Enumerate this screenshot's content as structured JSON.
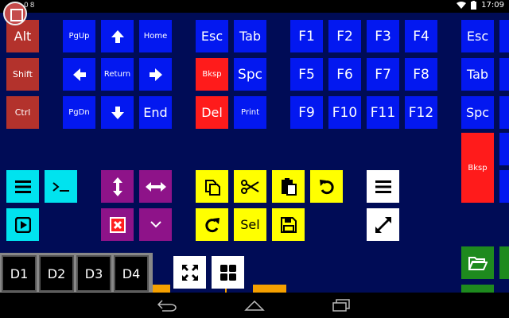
{
  "status_bar": {
    "left_indicators": "08",
    "time": "17:09"
  },
  "keys": {
    "alt": "Alt",
    "shift": "Shift",
    "ctrl": "Ctrl",
    "pgup": "PgUp",
    "home": "Home",
    "return": "Return",
    "pgdn": "PgDn",
    "end": "End",
    "esc": "Esc",
    "tab": "Tab",
    "bksp": "Bksp",
    "spc": "Spc",
    "del": "Del",
    "print": "Print",
    "f1": "F1",
    "f2": "F2",
    "f3": "F3",
    "f4": "F4",
    "f5": "F5",
    "f6": "F6",
    "f7": "F7",
    "f8": "F8",
    "f9": "F9",
    "f10": "F10",
    "f11": "F11",
    "f12": "F12",
    "esc2": "Esc",
    "tab2": "Tab",
    "spc2": "Spc",
    "bksp2": "Bksp",
    "sel": "Sel",
    "d1": "D1",
    "d2": "D2",
    "d3": "D3",
    "d4": "D4"
  },
  "colors": {
    "background": "#000c56",
    "modifier": "#b3322c",
    "blue": "#0318f0",
    "red": "#ff1b1b",
    "cyan": "#00e3ef",
    "purple": "#8e1389",
    "yellow": "#ffff00",
    "green": "#1e8a1e",
    "orange": "#f5a000"
  }
}
